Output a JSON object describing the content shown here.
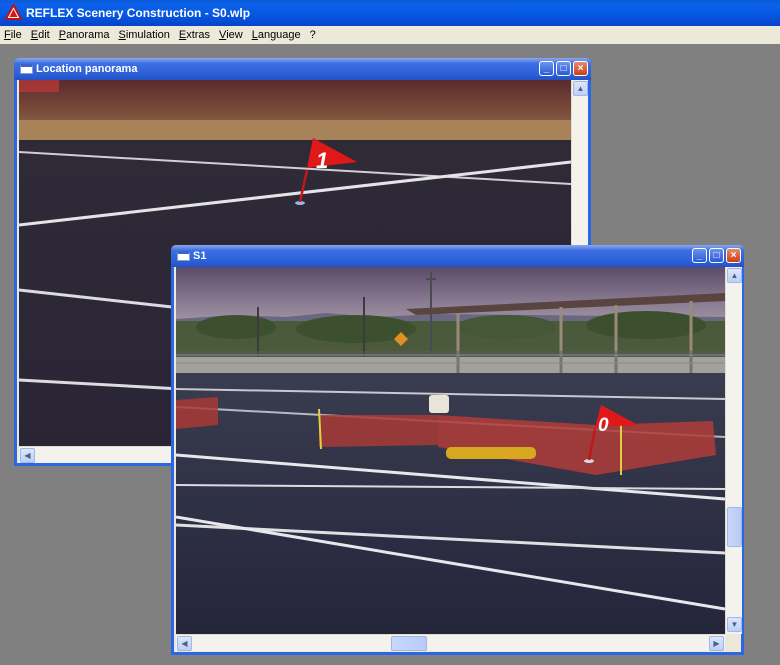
{
  "app": {
    "title": "REFLEX Scenery Construction - S0.wlp"
  },
  "menu": [
    "File",
    "Edit",
    "Panorama",
    "Simulation",
    "Extras",
    "View",
    "Language",
    "?"
  ],
  "windows": {
    "location": {
      "title": "Location panorama",
      "flag_label": "1"
    },
    "s1": {
      "title": "S1",
      "flag_label": "0"
    }
  },
  "window_controls": {
    "minimize": "_",
    "maximize": "□",
    "close": "×"
  },
  "scroll_arrows": {
    "up": "▲",
    "down": "▼",
    "left": "◀",
    "right": "▶"
  },
  "colors": {
    "titlebar": "#0656e0",
    "window_border": "#2a67e8",
    "flag": "#e01818",
    "workspace": "#808080"
  }
}
